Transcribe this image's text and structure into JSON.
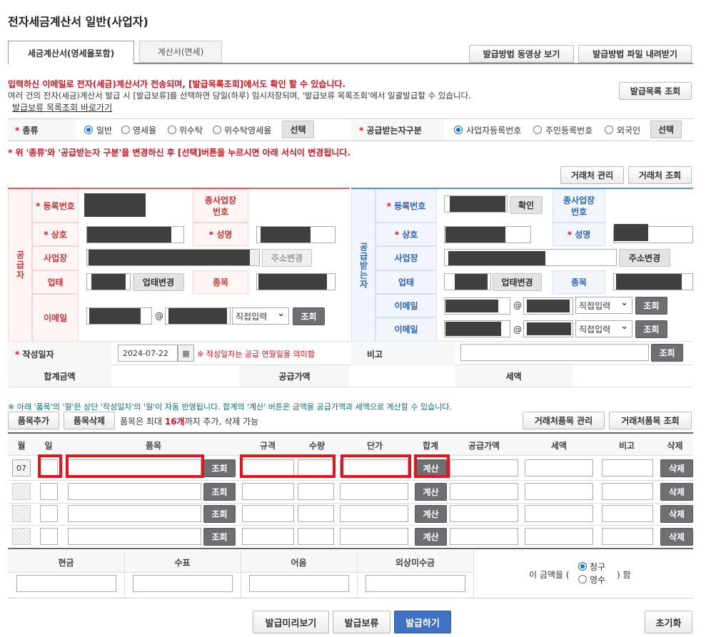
{
  "title": "전자세금계산서 일반(사업자)",
  "tabs": [
    {
      "label": "세금계산서(영세율포함)",
      "active": true
    },
    {
      "label": "계산서(면세)",
      "active": false
    }
  ],
  "top_buttons": {
    "video": "발급방법 동영상 보기",
    "download": "발급방법 파일 내려받기",
    "list": "발급목록 조회"
  },
  "notice": {
    "line1": "입력하신 이메일로 전자(세금)계산서가 전송되며, [발급목록조회]에서도 확인 할 수 있습니다.",
    "line2": "여러 건의 전자(세금)계산서 발급 시 [발급보류]를 선택하면 당일(하루) 임시저장되며, '발급보류 목록조회'에서 일괄발급할 수 있습니다.",
    "link": "발급보류 목록조회 바로가기"
  },
  "type_row": {
    "label": "종류",
    "options": [
      "일반",
      "영세율",
      "위수탁",
      "위수탁영세율"
    ],
    "selected": "일반",
    "select_btn": "선택",
    "recv_label": "공급받는자구분",
    "recv_options": [
      "사업자등록번호",
      "주민등록번호",
      "외국인"
    ],
    "recv_selected": "사업자등록번호",
    "recv_btn": "선택"
  },
  "warning": "* 위 '종류'와 '공급받는자 구분'을 변경하신 후 [선택]버튼을 누르시면 아래 서식이 변경됩니다.",
  "partner_buttons": {
    "manage": "거래처 관리",
    "search": "거래처 조회"
  },
  "supplier": {
    "side": "공급자",
    "reg_no": "등록번호",
    "sub_no": "종사업장번호",
    "name": "상호",
    "ceo": "성명",
    "addr": "사업장",
    "addr_btn": "주소변경",
    "biz_type": "업태",
    "biz_btn": "업태변경",
    "item": "종목",
    "email": "이메일",
    "email_at": "@",
    "email_domain": "직접입력",
    "email_btn": "조회"
  },
  "receiver": {
    "side": "공급받는자",
    "reg_no": "등록번호",
    "confirm": "확인",
    "sub_no": "종사업장번호",
    "name": "상호",
    "ceo": "성명",
    "addr": "사업장",
    "addr_btn": "주소변경",
    "biz_type": "업태",
    "biz_btn": "업태변경",
    "item": "종목",
    "email": "이메일",
    "email_at": "@",
    "email_domain": "직접입력",
    "email_btn": "조회"
  },
  "date_row": {
    "label": "작성일자",
    "value": "2024-07-22",
    "note": "※ 작성일자는 공급 연월일을 의미함",
    "memo": "비고",
    "memo_btn": "조회"
  },
  "sum_row": {
    "total": "합계금액",
    "supply": "공급가액",
    "tax": "세액"
  },
  "items_notice": "※ 아래 '품목'의 '월'은 상단 '작성일자'의 '월'이 자동 반영됩니다. 합계의 '계산' 버튼은 금액을 공급가액과 세액으로 계산할 수 있습니다.",
  "items_bar": {
    "add": "품목추가",
    "del": "품목삭제",
    "info_pre": "품목은 최대 ",
    "info_num": "16개",
    "info_post": "까지 추가, 삭제 가능",
    "manage": "거래처품목 관리",
    "search": "거래처품목 조회"
  },
  "items_header": [
    "월",
    "일",
    "품목",
    "규격",
    "수량",
    "단가",
    "합계",
    "공급가액",
    "세액",
    "비고",
    "삭제"
  ],
  "items": [
    {
      "month": "07",
      "search": "조회",
      "calc": "계산",
      "del": "삭제"
    },
    {
      "month": "",
      "search": "조회",
      "calc": "계산",
      "del": "삭제"
    },
    {
      "month": "",
      "search": "조회",
      "calc": "계산",
      "del": "삭제"
    },
    {
      "month": "",
      "search": "조회",
      "calc": "계산",
      "del": "삭제"
    }
  ],
  "pay_header": [
    "현금",
    "수표",
    "어음",
    "외상미수금"
  ],
  "pay_suffix": {
    "pre": "이 금액을 (",
    "opt1": "청구",
    "opt2": "영수",
    "post": ") 함",
    "selected": "청구"
  },
  "bottom_buttons": {
    "preview": "발급미리보기",
    "hold": "발급보류",
    "issue": "발급하기",
    "reset": "초기화"
  },
  "colors": {
    "accent": "#3f72c4",
    "red": "#d4121e",
    "highlight": "#e8141c"
  }
}
